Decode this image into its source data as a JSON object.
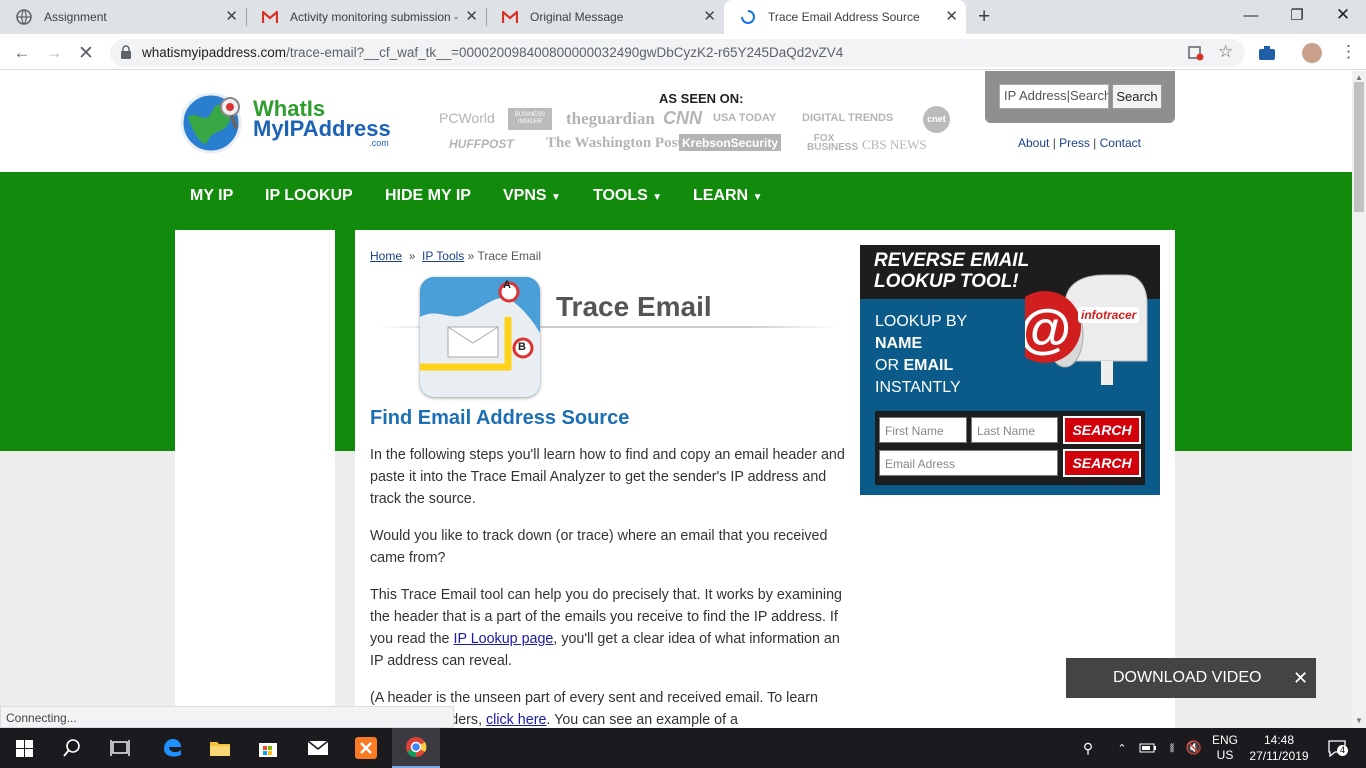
{
  "browser": {
    "tabs": [
      {
        "title": "Assignment",
        "icon": "globe-icon"
      },
      {
        "title": "Activity monitoring submission -",
        "icon": "gmail-icon"
      },
      {
        "title": "Original Message",
        "icon": "gmail-icon"
      },
      {
        "title": "Trace Email Address Source",
        "icon": "loading-spinner-icon",
        "active": true
      }
    ],
    "new_tab": "+",
    "url_domain": "whatismyipaddress.com",
    "url_path": "/trace-email?__cf_waf_tk__=000020098400800000032490gwDbCyzK2-r65Y245DaQd2vZV4",
    "status_text": "Connecting..."
  },
  "site": {
    "logo_line1": "WhatIs",
    "logo_line2": "MyIPAddress",
    "logo_line3": ".com",
    "as_seen_on": "AS SEEN ON:",
    "press": [
      "PCWorld",
      "BUSINESS INSIDER",
      "theguardian",
      "CNN",
      "USA TODAY",
      "DIGITAL TRENDS",
      "cnet",
      "HUFFPOST",
      "The Washington Post",
      "KrebsonSecurity",
      "FOX BUSINESS",
      "CBS NEWS"
    ],
    "search": {
      "placeholder": "IP Address|Search",
      "button": "Search"
    },
    "toplinks": [
      "About",
      "Press",
      "Contact"
    ],
    "nav": [
      "MY IP",
      "IP LOOKUP",
      "HIDE MY IP",
      "VPNS",
      "TOOLS",
      "LEARN"
    ]
  },
  "breadcrumb": {
    "home": "Home",
    "sep": "»",
    "tools": "IP Tools",
    "current": "Trace Email"
  },
  "article": {
    "banner_title": "Trace Email",
    "heading": "Find Email Address Source",
    "p1": "In the following steps you'll learn how to find and copy an email header and paste it into the Trace Email Analyzer to get the sender's IP address and track the source.",
    "p2": "Would you like to track down (or trace) where an email that you received came from?",
    "p3_a": "This Trace Email tool can help you do precisely that. It works by examining the header that is a part of the emails you receive to find the IP address. If you read the ",
    "p3_link": "IP Lookup page",
    "p3_b": ", you'll get a clear idea of what information an IP address can reveal.",
    "p4_a": "(A header is the unseen part of every sent and received email. To learn more on headers, ",
    "p4_link": "click here",
    "p4_b": ". You can see an example of a"
  },
  "ad": {
    "headline1": "REVERSE EMAIL",
    "headline2": "LOOKUP TOOL!",
    "l1": "LOOKUP BY",
    "l2": "NAME",
    "l3a": "OR ",
    "l3b": "EMAIL",
    "l4": "INSTANTLY",
    "brand": "infotracer",
    "first_name": "First Name",
    "last_name": "Last Name",
    "email": "Email Adress",
    "search": "SEARCH"
  },
  "popup": {
    "label": "DOWNLOAD VIDEO",
    "close": "✕"
  },
  "taskbar": {
    "lang1": "ENG",
    "lang2": "US",
    "time": "14:48",
    "date": "27/11/2019",
    "notif": "4"
  }
}
